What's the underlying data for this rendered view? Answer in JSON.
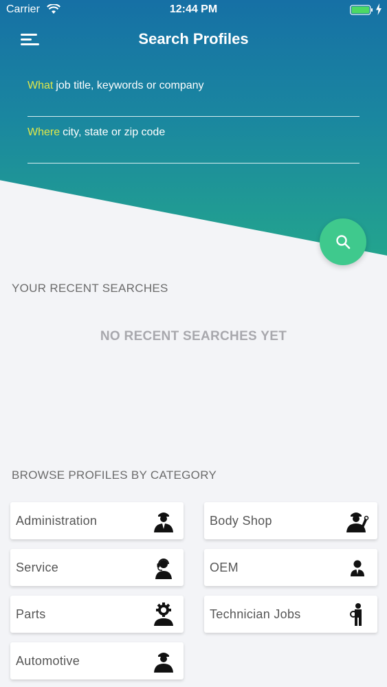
{
  "status": {
    "carrier": "Carrier",
    "time": "12:44 PM"
  },
  "header": {
    "title": "Search Profiles",
    "menu_icon": "hamburger-menu-icon"
  },
  "search": {
    "what_key": "What",
    "what_placeholder": "job title, keywords or company",
    "where_key": "Where",
    "where_placeholder": "city, state or zip code",
    "button_icon": "search-icon"
  },
  "recent": {
    "title": "YOUR RECENT SEARCHES",
    "empty": "NO RECENT SEARCHES YET"
  },
  "browse": {
    "title": "BROWSE PROFILES BY CATEGORY",
    "categories": [
      {
        "label": "Administration",
        "icon": "manager-icon"
      },
      {
        "label": "Body Shop",
        "icon": "mechanic-icon"
      },
      {
        "label": "Service",
        "icon": "customer-service-icon"
      },
      {
        "label": "OEM",
        "icon": "businessman-icon"
      },
      {
        "label": "Parts",
        "icon": "gear-worker-icon"
      },
      {
        "label": "Technician Jobs",
        "icon": "technician-icon"
      },
      {
        "label": "Automotive",
        "icon": "worker-icon"
      }
    ]
  },
  "colors": {
    "accent_green": "#3fc98d",
    "highlight_yellow": "#e0e84a",
    "header_blue": "#1670a5",
    "header_teal": "#23a48e"
  }
}
